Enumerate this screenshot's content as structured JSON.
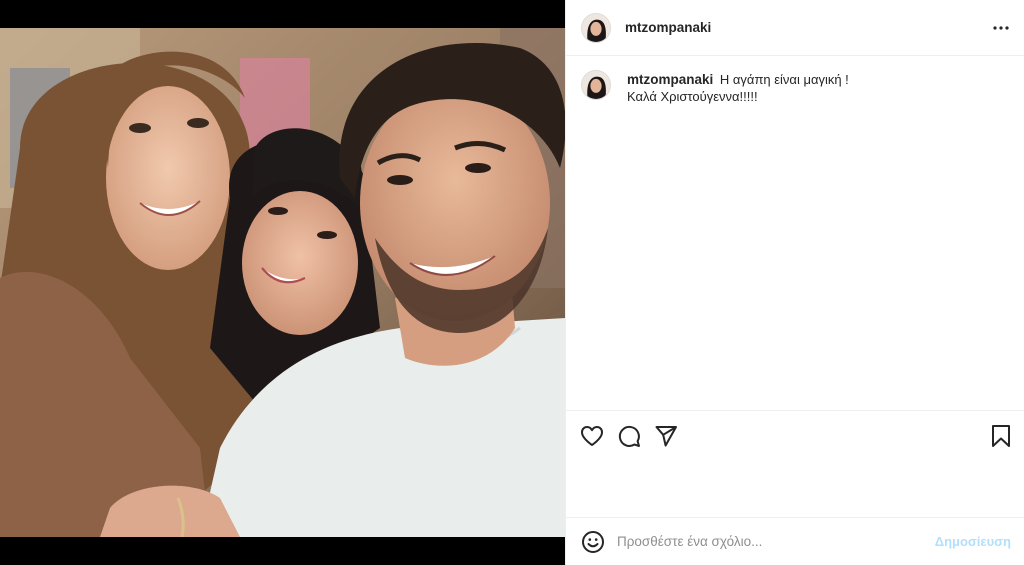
{
  "post": {
    "username": "mtzompanaki",
    "more_icon": "more-horizontal-icon",
    "caption_lines": [
      "Η αγάπη είναι μαγική !",
      "Καλά Χριστούγεννα!!!!!"
    ],
    "image": "selfie-photo"
  },
  "actions": {
    "like_icon": "heart-icon",
    "comment_icon": "comment-icon",
    "share_icon": "send-icon",
    "save_icon": "bookmark-icon"
  },
  "comment_bar": {
    "emoji_icon": "emoji-icon",
    "placeholder": "Προσθέστε ένα σχόλιο...",
    "post_label": "Δημοσίευση",
    "post_color": "#b2dffc"
  },
  "colors": {
    "text": "#262626",
    "secondary_text": "#8e8e8e",
    "border": "#efefef",
    "media_background": "#000000"
  }
}
